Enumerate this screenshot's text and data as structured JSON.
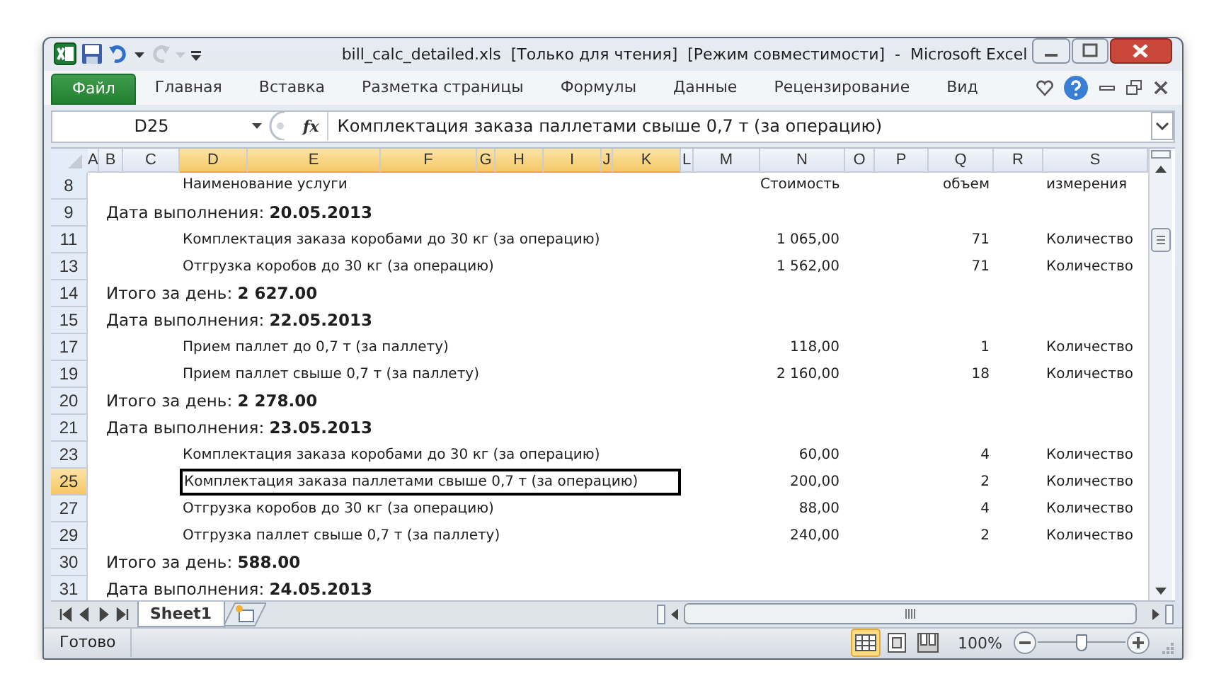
{
  "window": {
    "title": "bill_calc_detailed.xls  [Только для чтения]  [Режим совместимости]  -  Microsoft Excel"
  },
  "quick_access": [
    {
      "kind": "undo",
      "disabled": false
    },
    {
      "kind": "redo",
      "disabled": true
    }
  ],
  "ribbon": {
    "file_tab": "Файл",
    "tabs": [
      {
        "label": "Главная",
        "selected": false
      },
      {
        "label": "Вставка",
        "selected": false
      },
      {
        "label": "Разметка страницы",
        "selected": false
      },
      {
        "label": "Формулы",
        "selected": false
      },
      {
        "label": "Данные",
        "selected": false
      },
      {
        "label": "Рецензирование",
        "selected": false
      },
      {
        "label": "Вид",
        "selected": false
      }
    ]
  },
  "formula_bar": {
    "name_box": "D25",
    "function_label": "fx",
    "formula": "Комплектация заказа паллетами свыше 0,7 т (за операцию)"
  },
  "columns": [
    {
      "label": "A",
      "selected": false
    },
    {
      "label": "B",
      "selected": false
    },
    {
      "label": "C",
      "selected": false
    },
    {
      "label": "D",
      "selected": true
    },
    {
      "label": "E",
      "selected": true
    },
    {
      "label": "F",
      "selected": true
    },
    {
      "label": "G",
      "selected": true
    },
    {
      "label": "H",
      "selected": true
    },
    {
      "label": "I",
      "selected": true
    },
    {
      "label": "J",
      "selected": true
    },
    {
      "label": "K",
      "selected": true
    },
    {
      "label": "L",
      "selected": false
    },
    {
      "label": "M",
      "selected": false
    },
    {
      "label": "N",
      "selected": false
    },
    {
      "label": "O",
      "selected": false
    },
    {
      "label": "P",
      "selected": false
    },
    {
      "label": "Q",
      "selected": false
    },
    {
      "label": "R",
      "selected": false
    },
    {
      "label": "S",
      "selected": false
    }
  ],
  "rows": [
    {
      "number": "8",
      "kind": "header",
      "label": "Наименование услуги",
      "cost": "Стоимость",
      "volume": "объем",
      "unit": "измерения",
      "selected": false
    },
    {
      "number": "9",
      "kind": "date",
      "label": "Дата выполнения: **20.05.2013**",
      "selected": false
    },
    {
      "number": "11",
      "kind": "item",
      "label": "Комплектация заказа коробами до 30 кг (за операцию)",
      "cost": "1 065,00",
      "volume": "71",
      "unit": "Количество",
      "selected": false
    },
    {
      "number": "13",
      "kind": "item",
      "label": "Отгрузка коробов до 30 кг (за операцию)",
      "cost": "1 562,00",
      "volume": "71",
      "unit": "Количество",
      "selected": false
    },
    {
      "number": "14",
      "kind": "total",
      "label": "Итого за день: **2 627.00**",
      "selected": false
    },
    {
      "number": "15",
      "kind": "date",
      "label": "Дата выполнения: **22.05.2013**",
      "selected": false
    },
    {
      "number": "17",
      "kind": "item",
      "label": "Прием паллет до 0,7 т (за паллету)",
      "cost": "118,00",
      "volume": "1",
      "unit": "Количество",
      "selected": false
    },
    {
      "number": "19",
      "kind": "item",
      "label": "Прием паллет свыше 0,7 т (за паллету)",
      "cost": "2 160,00",
      "volume": "18",
      "unit": "Количество",
      "selected": false
    },
    {
      "number": "20",
      "kind": "total",
      "label": "Итого за день: **2 278.00**",
      "selected": false
    },
    {
      "number": "21",
      "kind": "date",
      "label": "Дата выполнения: **23.05.2013**",
      "selected": false
    },
    {
      "number": "23",
      "kind": "item",
      "label": "Комплектация заказа коробами до 30 кг (за операцию)",
      "cost": "60,00",
      "volume": "4",
      "unit": "Количество",
      "selected": false
    },
    {
      "number": "25",
      "kind": "item",
      "label": "Комплектация заказа паллетами свыше 0,7 т (за операцию)",
      "cost": "200,00",
      "volume": "2",
      "unit": "Количество",
      "selected": true
    },
    {
      "number": "27",
      "kind": "item",
      "label": "Отгрузка коробов до 30 кг (за операцию)",
      "cost": "88,00",
      "volume": "4",
      "unit": "Количество",
      "selected": false
    },
    {
      "number": "29",
      "kind": "item",
      "label": "Отгрузка паллет свыше 0,7 т (за паллету)",
      "cost": "240,00",
      "volume": "2",
      "unit": "Количество",
      "selected": false
    },
    {
      "number": "30",
      "kind": "total",
      "label": "Итого за день: **588.00**",
      "selected": false
    },
    {
      "number": "31",
      "kind": "date",
      "label": "Дата выполнения: **24.05.2013**",
      "selected": false
    }
  ],
  "sheet_tabs": [
    {
      "label": "Sheet1",
      "selected": true
    }
  ],
  "status_bar": {
    "status": "Готово",
    "views": [
      {
        "kind": "normal",
        "selected": true
      },
      {
        "kind": "page_layout",
        "selected": false
      },
      {
        "kind": "page_break",
        "selected": false
      }
    ],
    "zoom": "100%",
    "zoom_slider": {
      "level": 0.5
    }
  }
}
